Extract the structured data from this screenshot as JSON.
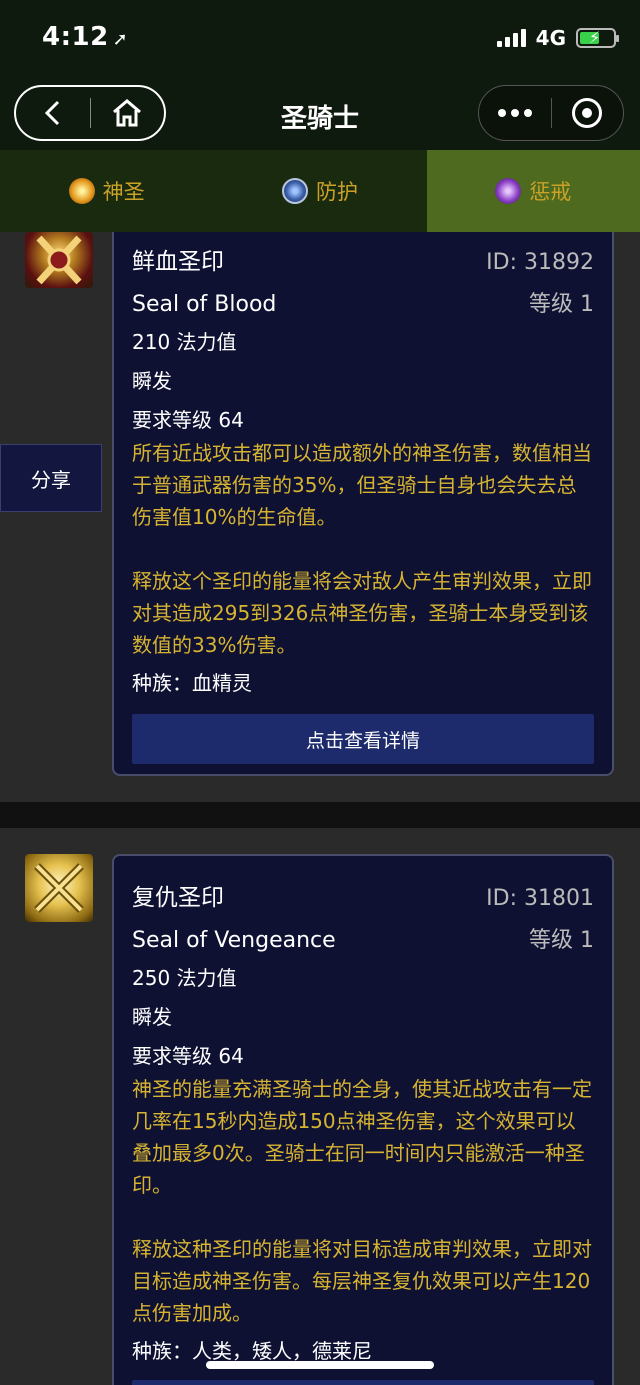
{
  "status": {
    "time": "4:12",
    "network": "4G"
  },
  "nav": {
    "title": "圣骑士"
  },
  "tabs": [
    {
      "label": "神圣",
      "icon": "holy-icon",
      "active": false
    },
    {
      "label": "防护",
      "icon": "protection-icon",
      "active": false
    },
    {
      "label": "惩戒",
      "icon": "retribution-icon",
      "active": true
    }
  ],
  "share_label": "分享",
  "spells": [
    {
      "name_cn": "鲜血圣印",
      "id": "ID: 31892",
      "name_en": "Seal of Blood",
      "level": "等级 1",
      "cost": "210 法力值",
      "cast": "瞬发",
      "req": "要求等级 64",
      "desc1": "所有近战攻击都可以造成额外的神圣伤害，数值相当于普通武器伤害的35%，但圣骑士自身也会失去总伤害值10%的生命值。",
      "desc2": "释放这个圣印的能量将会对敌人产生审判效果，立即对其造成295到326点神圣伤害，圣骑士本身受到该数值的33%伤害。",
      "race": "种族：血精灵",
      "button": "点击查看详情"
    },
    {
      "name_cn": "复仇圣印",
      "id": "ID: 31801",
      "name_en": "Seal of Vengeance",
      "level": "等级 1",
      "cost": "250 法力值",
      "cast": "瞬发",
      "req": "要求等级 64",
      "desc1": "神圣的能量充满圣骑士的全身，使其近战攻击有一定几率在15秒内造成150点神圣伤害，这个效果可以叠加最多0次。圣骑士在同一时间内只能激活一种圣印。",
      "desc2": "释放这种圣印的能量将对目标造成审判效果，立即对目标造成神圣伤害。每层神圣复仇效果可以产生120点伤害加成。",
      "race": "种族：人类，矮人，德莱尼"
    }
  ]
}
